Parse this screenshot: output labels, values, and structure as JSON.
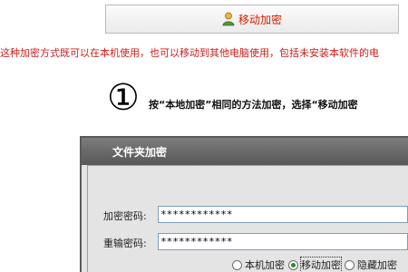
{
  "top_button": {
    "label": "移动加密",
    "icon": "user-icon"
  },
  "description": "这种加密方式既可以在本机使用，也可以移动到其他电脑使用，包括未安装本软件的电",
  "step": {
    "number": "①",
    "instruction": "按“本地加密”相同的方法加密，选择“移动加密"
  },
  "dialog": {
    "title": "文件夹加密",
    "password_label": "加密密码:",
    "password_value": "************",
    "confirm_label": "重输密码:",
    "confirm_value": "************",
    "options": [
      "本机加密",
      "移动加密",
      "隐藏加密"
    ],
    "selected_option": "移动加密"
  },
  "colors": {
    "accent_red": "#c81e1e",
    "titlebar": "#6a6a6a",
    "radio_selected": "#2a8a2a"
  }
}
